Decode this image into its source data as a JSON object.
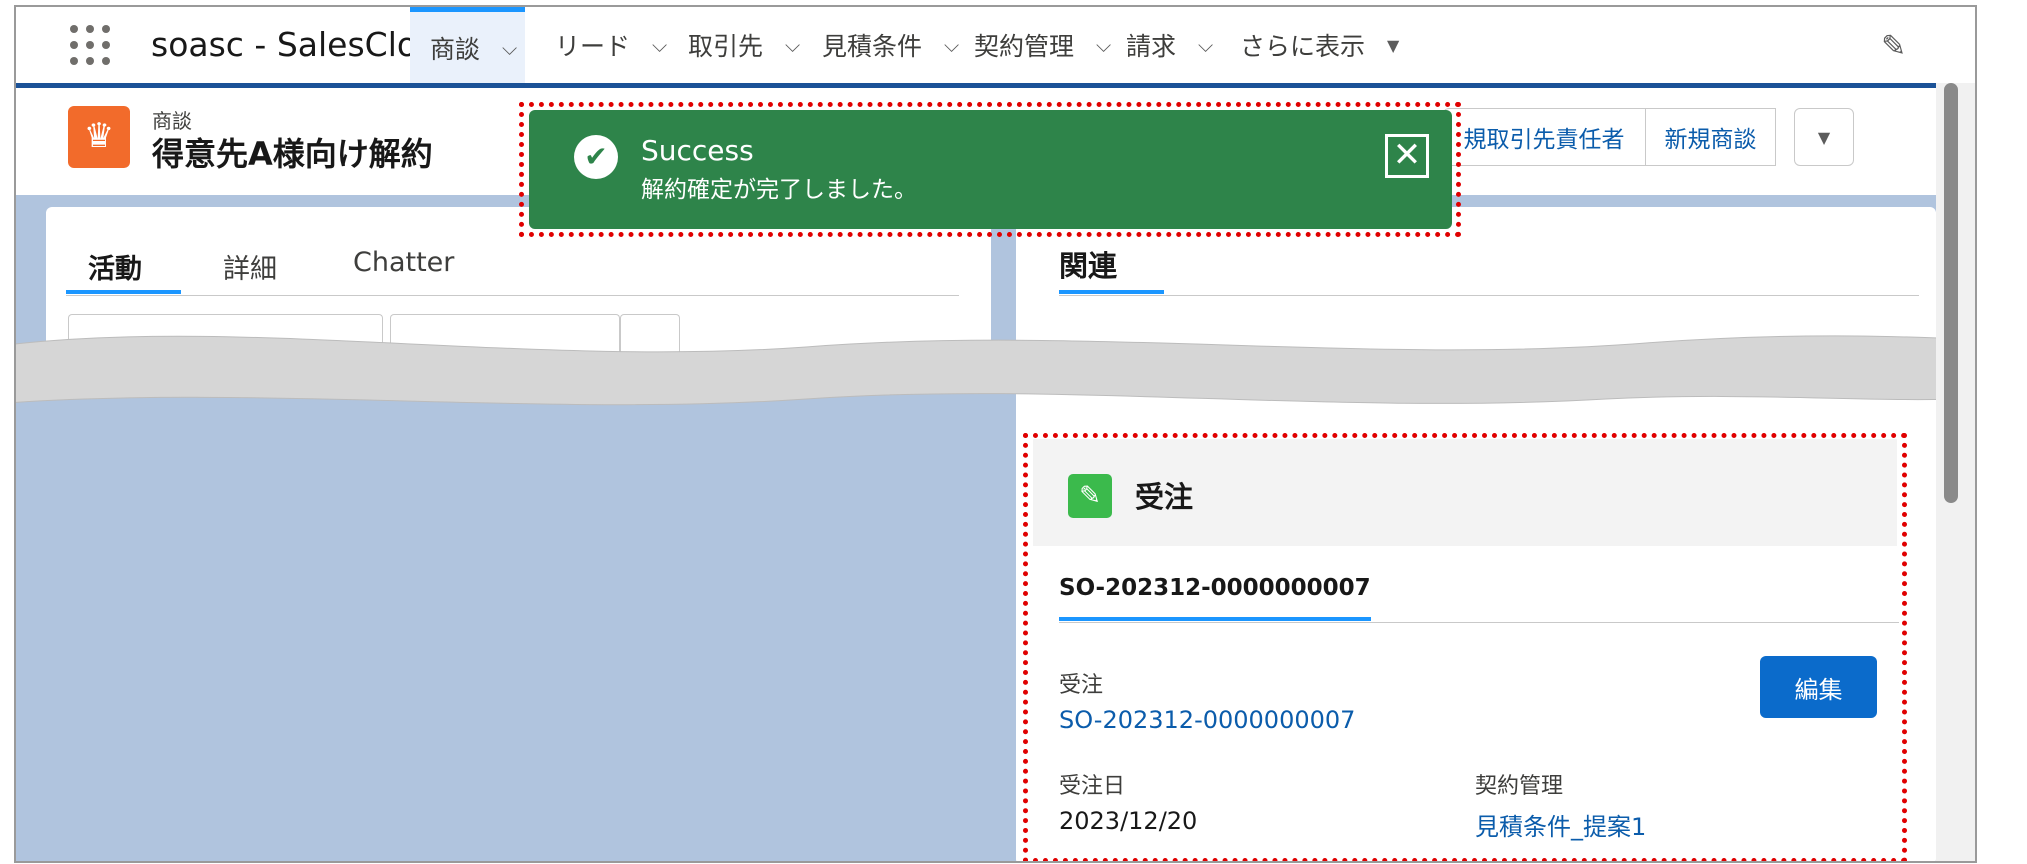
{
  "nav": {
    "app_name": "soasc - SalesCloud ...",
    "items": [
      {
        "label": "商談"
      },
      {
        "label": "リード"
      },
      {
        "label": "取引先"
      },
      {
        "label": "見積条件"
      },
      {
        "label": "契約管理"
      },
      {
        "label": "請求"
      },
      {
        "label": "さらに表示"
      }
    ],
    "chevron": "⌵",
    "more_arrow": "▼",
    "pencil": "✎"
  },
  "record": {
    "type_label": "商談",
    "title": "得意先A様向け解約",
    "icon": "♛",
    "buttons": [
      {
        "label": "規取引先責任者"
      },
      {
        "label": "新規商談"
      },
      {
        "label": "▼"
      }
    ]
  },
  "tabs": {
    "left": [
      {
        "label": "活動"
      },
      {
        "label": "詳細"
      },
      {
        "label": "Chatter"
      }
    ],
    "right": {
      "label": "関連"
    }
  },
  "order": {
    "icon": "✎",
    "title": "受注",
    "tab": "SO-202312-0000000007",
    "fields": {
      "order_label": "受注",
      "order_value": "SO-202312-0000000007",
      "date_label": "受注日",
      "date_value": "2023/12/20",
      "contract_label": "契約管理",
      "contract_value": "見積条件_提案1"
    },
    "edit_label": "編集"
  },
  "toast": {
    "title": "Success",
    "message": "解約確定が完了しました。",
    "check": "✔",
    "close": "✕"
  },
  "colors": {
    "nav_accent": "#1b96ff",
    "toast_bg": "#2e844a",
    "annotation_red": "#e00000",
    "brand_blue": "#0b6bcb"
  }
}
